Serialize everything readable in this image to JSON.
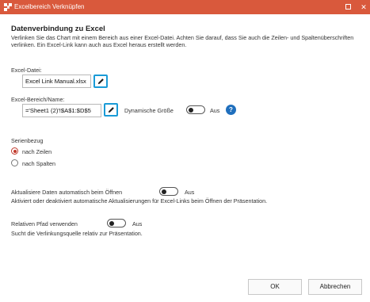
{
  "window": {
    "title": "Excelbereich Verknüpfen",
    "maximize_icon": "maximize-icon",
    "close_glyph": "✕",
    "accent": "#d9593c"
  },
  "section": {
    "title": "Datenverbindung zu Excel",
    "intro": "Verlinken Sie das Chart mit einem Bereich aus einer Excel-Datei. Achten Sie darauf, dass Sie auch die Zeilen- und Spaltenüberschriften verlinken. Ein Excel-Link kann auch aus Excel heraus erstellt werden."
  },
  "excel_file": {
    "label": "Excel-Datei:",
    "value": "Excel Link Manual.xlsx"
  },
  "excel_range": {
    "label": "Excel-Bereich/Name:",
    "value": "='Sheet1 (2)'!$A$1:$D$5",
    "dynamic_label": "Dynamische Größe",
    "dynamic_state": "Aus",
    "help_glyph": "?"
  },
  "series": {
    "label": "Serienbezug",
    "options": [
      "nach Zeilen",
      "nach Spalten"
    ],
    "selected": "nach Zeilen"
  },
  "auto_update": {
    "label": "Aktualisiere Daten automatisch beim Öffnen",
    "state": "Aus",
    "description": "Aktiviert oder deaktiviert automatische Aktualisierungen für Excel-Links beim Öffnen der Präsentation."
  },
  "relative_path": {
    "label": "Relativen Pfad verwenden",
    "state": "Aus",
    "description": "Sucht die Verlinkungsquelle relativ zur Präsentation."
  },
  "buttons": {
    "ok": "OK",
    "cancel": "Abbrechen"
  }
}
